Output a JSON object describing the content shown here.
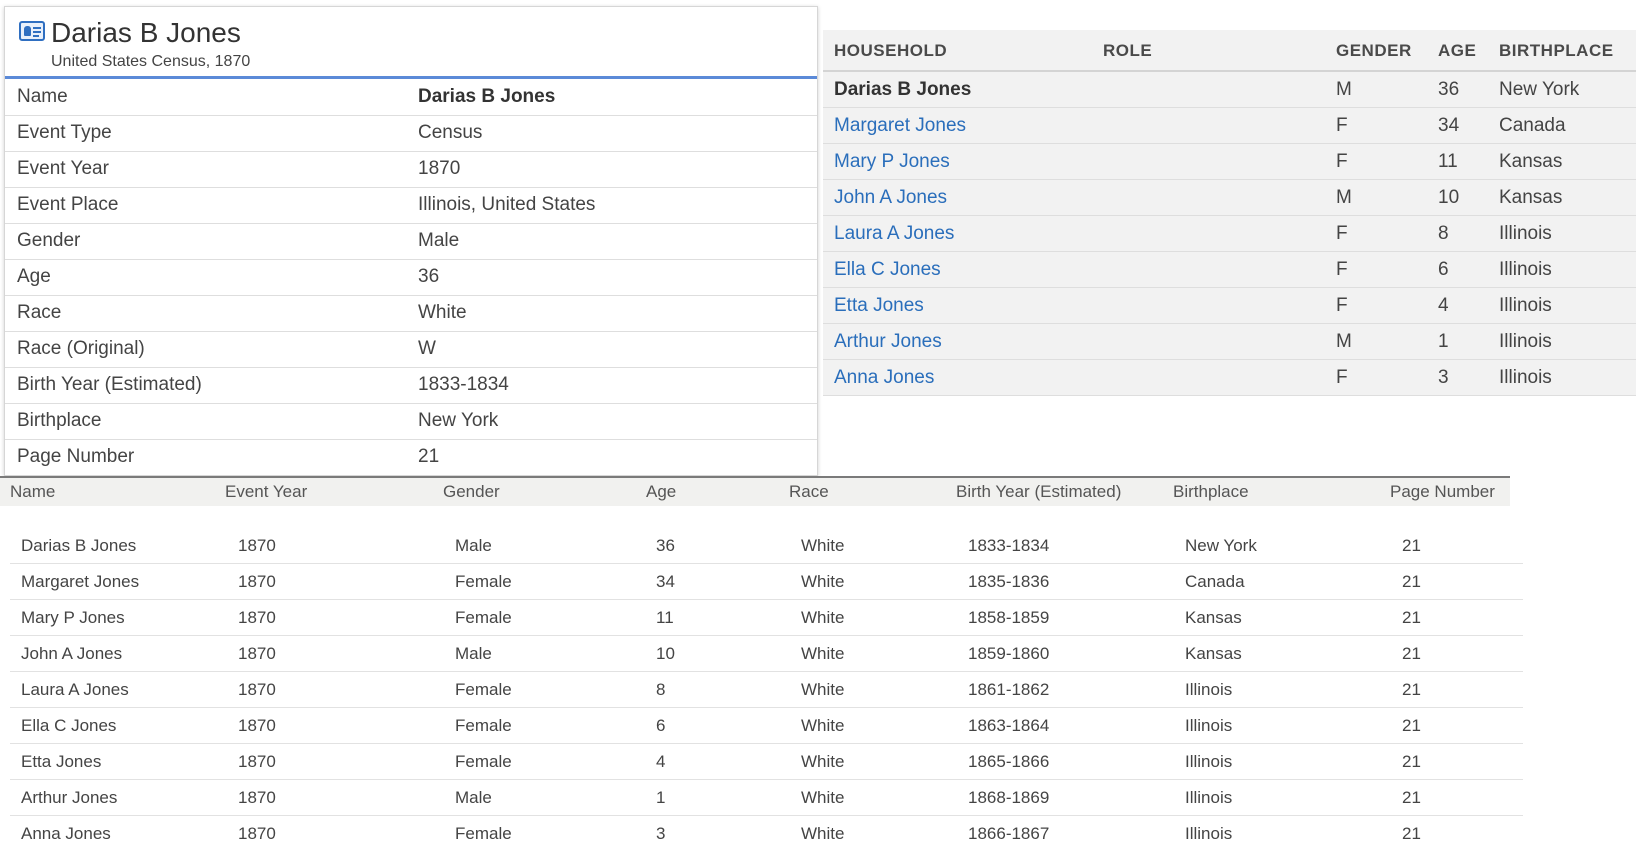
{
  "record": {
    "title": "Darias B Jones",
    "subtitle": "United States Census, 1870",
    "icon": "record-card-icon",
    "fields": [
      {
        "label": "Name",
        "value": "Darias B Jones"
      },
      {
        "label": "Event Type",
        "value": "Census"
      },
      {
        "label": "Event Year",
        "value": "1870"
      },
      {
        "label": "Event Place",
        "value": "Illinois, United States"
      },
      {
        "label": "Gender",
        "value": "Male"
      },
      {
        "label": "Age",
        "value": "36"
      },
      {
        "label": "Race",
        "value": "White"
      },
      {
        "label": "Race (Original)",
        "value": "W"
      },
      {
        "label": "Birth Year (Estimated)",
        "value": "1833-1834"
      },
      {
        "label": "Birthplace",
        "value": "New York"
      },
      {
        "label": "Page Number",
        "value": "21"
      }
    ]
  },
  "household": {
    "headers": {
      "household": "HOUSEHOLD",
      "role": "ROLE",
      "gender": "GENDER",
      "age": "AGE",
      "birthplace": "BIRTHPLACE"
    },
    "rows": [
      {
        "name": "Darias B Jones",
        "role": "",
        "gender": "M",
        "age": "36",
        "birthplace": "New York"
      },
      {
        "name": "Margaret Jones",
        "role": "",
        "gender": "F",
        "age": "34",
        "birthplace": "Canada"
      },
      {
        "name": "Mary P Jones",
        "role": "",
        "gender": "F",
        "age": "11",
        "birthplace": "Kansas"
      },
      {
        "name": "John A Jones",
        "role": "",
        "gender": "M",
        "age": "10",
        "birthplace": "Kansas"
      },
      {
        "name": "Laura A Jones",
        "role": "",
        "gender": "F",
        "age": "8",
        "birthplace": "Illinois"
      },
      {
        "name": "Ella C Jones",
        "role": "",
        "gender": "F",
        "age": "6",
        "birthplace": "Illinois"
      },
      {
        "name": "Etta Jones",
        "role": "",
        "gender": "F",
        "age": "4",
        "birthplace": "Illinois"
      },
      {
        "name": "Arthur Jones",
        "role": "",
        "gender": "M",
        "age": "1",
        "birthplace": "Illinois"
      },
      {
        "name": "Anna Jones",
        "role": "",
        "gender": "F",
        "age": "3",
        "birthplace": "Illinois"
      }
    ]
  },
  "summary": {
    "headers": {
      "name": "Name",
      "event_year": "Event Year",
      "gender": "Gender",
      "age": "Age",
      "race": "Race",
      "birth_year": "Birth Year (Estimated)",
      "birthplace": "Birthplace",
      "page_number": "Page Number"
    },
    "rows": [
      {
        "name": "Darias B Jones",
        "event_year": "1870",
        "gender": "Male",
        "age": "36",
        "race": "White",
        "birth_year": "1833-1834",
        "birthplace": "New York",
        "page_number": "21"
      },
      {
        "name": "Margaret Jones",
        "event_year": "1870",
        "gender": "Female",
        "age": "34",
        "race": "White",
        "birth_year": "1835-1836",
        "birthplace": "Canada",
        "page_number": "21"
      },
      {
        "name": "Mary P Jones",
        "event_year": "1870",
        "gender": "Female",
        "age": "11",
        "race": "White",
        "birth_year": "1858-1859",
        "birthplace": "Kansas",
        "page_number": "21"
      },
      {
        "name": "John A Jones",
        "event_year": "1870",
        "gender": "Male",
        "age": "10",
        "race": "White",
        "birth_year": "1859-1860",
        "birthplace": "Kansas",
        "page_number": "21"
      },
      {
        "name": "Laura A Jones",
        "event_year": "1870",
        "gender": "Female",
        "age": "8",
        "race": "White",
        "birth_year": "1861-1862",
        "birthplace": "Illinois",
        "page_number": "21"
      },
      {
        "name": "Ella C Jones",
        "event_year": "1870",
        "gender": "Female",
        "age": "6",
        "race": "White",
        "birth_year": "1863-1864",
        "birthplace": "Illinois",
        "page_number": "21"
      },
      {
        "name": "Etta Jones",
        "event_year": "1870",
        "gender": "Female",
        "age": "4",
        "race": "White",
        "birth_year": "1865-1866",
        "birthplace": "Illinois",
        "page_number": "21"
      },
      {
        "name": "Arthur Jones",
        "event_year": "1870",
        "gender": "Male",
        "age": "1",
        "race": "White",
        "birth_year": "1868-1869",
        "birthplace": "Illinois",
        "page_number": "21"
      },
      {
        "name": "Anna Jones",
        "event_year": "1870",
        "gender": "Female",
        "age": "3",
        "race": "White",
        "birth_year": "1866-1867",
        "birthplace": "Illinois",
        "page_number": "21"
      }
    ]
  },
  "colors": {
    "link": "#2a6ebb",
    "accent": "#5b8ad8",
    "household_bg": "#f2f2f2"
  }
}
